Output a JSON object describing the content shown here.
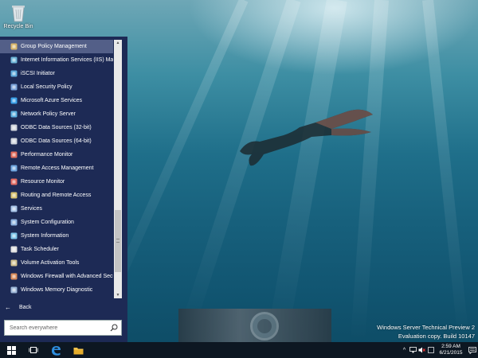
{
  "desktop": {
    "recycle_bin_label": "Recycle Bin",
    "watermark_line1": "Windows Server Technical Preview 2",
    "watermark_line2": "Evaluation copy. Build 10147"
  },
  "start_menu": {
    "items": [
      {
        "label": "Group Policy Management",
        "icon": "group-policy-icon",
        "selected": true
      },
      {
        "label": "Internet Information Services (IIS) Ma",
        "icon": "iis-icon"
      },
      {
        "label": "iSCSI Initiator",
        "icon": "iscsi-icon"
      },
      {
        "label": "Local Security Policy",
        "icon": "security-policy-icon"
      },
      {
        "label": "Microsoft Azure Services",
        "icon": "azure-icon"
      },
      {
        "label": "Network Policy Server",
        "icon": "network-policy-icon"
      },
      {
        "label": "ODBC Data Sources (32-bit)",
        "icon": "odbc-icon"
      },
      {
        "label": "ODBC Data Sources (64-bit)",
        "icon": "odbc-icon"
      },
      {
        "label": "Performance Monitor",
        "icon": "performance-icon"
      },
      {
        "label": "Remote Access Management",
        "icon": "remote-access-icon"
      },
      {
        "label": "Resource Monitor",
        "icon": "resource-monitor-icon"
      },
      {
        "label": "Routing and Remote Access",
        "icon": "routing-icon"
      },
      {
        "label": "Services",
        "icon": "services-icon"
      },
      {
        "label": "System Configuration",
        "icon": "system-config-icon"
      },
      {
        "label": "System Information",
        "icon": "system-info-icon"
      },
      {
        "label": "Task Scheduler",
        "icon": "task-scheduler-icon"
      },
      {
        "label": "Volume Activation Tools",
        "icon": "volume-activation-icon"
      },
      {
        "label": "Windows Firewall with Advanced Secu",
        "icon": "firewall-icon"
      },
      {
        "label": "Windows Memory Diagnostic",
        "icon": "memory-diagnostic-icon"
      }
    ],
    "back_label": "Back",
    "search_placeholder": "Search everywhere"
  },
  "taskbar": {
    "time": "2:59 AM",
    "date": "6/21/2015"
  },
  "colors": {
    "start_menu_bg": "#1d2a55",
    "taskbar_bg": "#0d1722",
    "selected_item": "#7b84ad"
  }
}
